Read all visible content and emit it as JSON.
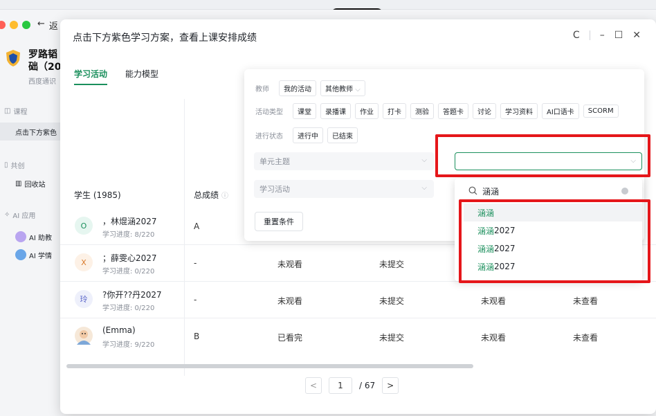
{
  "modal": {
    "title": "点击下方紫色学习方案，查看上课安排成绩",
    "ctrl_refresh": "C",
    "ctrl_min": "–",
    "ctrl_max": "☐",
    "ctrl_close": "✕"
  },
  "background": {
    "back_label": "返",
    "course_title": "罗路韬\n础（20",
    "course_sub": "西度通识",
    "nav_course_section": "课程",
    "nav_active_item": "点击下方紫色",
    "nav_shared_section": "共创",
    "nav_recycle": "回收站",
    "nav_ai_section": "AI 应用",
    "nav_ai_assistant": "AI 助教",
    "nav_ai_learning": "AI 学情"
  },
  "tabs": [
    {
      "label": "学习活动",
      "active": true
    },
    {
      "label": "能力模型",
      "active": false
    }
  ],
  "table": {
    "header_student": "学生 (1985)",
    "header_total": "总成绩",
    "rows": [
      {
        "avatar": "O",
        "avatar_color": "#e6f6f0",
        "avatar_text_color": "#1a8f5c",
        "name": "，林焜涵2027",
        "progress": "学习进度:  8/220",
        "total": "A",
        "c3": "",
        "c4": "",
        "c5": "",
        "c6": ""
      },
      {
        "avatar": "X",
        "avatar_color": "#fdf1e6",
        "avatar_text_color": "#d97a2b",
        "name": "；薛雯心2027",
        "progress": "学习进度:  0/220",
        "total": "-",
        "c3": "未观看",
        "c4": "未提交",
        "c5": "",
        "c6": ""
      },
      {
        "avatar": "玲",
        "avatar_color": "#eef0fb",
        "avatar_text_color": "#5b66c9",
        "name": "?你开??丹2027",
        "progress": "学习进度:  0/220",
        "total": "-",
        "c3": "未观看",
        "c4": "未提交",
        "c5": "未观看",
        "c6": "未查看"
      },
      {
        "avatar": "",
        "avatar_color": "#f6e8d8",
        "avatar_text_color": "#333",
        "name": "(Emma)",
        "progress": "学习进度:  9/220",
        "total": "B",
        "c3": "已看完",
        "c4": "未提交",
        "c5": "未观看",
        "c6": "未查看"
      }
    ]
  },
  "pager": {
    "prev": "<",
    "current": "1",
    "total": "/ 67",
    "next": ">"
  },
  "filter": {
    "teacher_label": "教师",
    "teacher_chips": [
      "我的活动",
      "其他教师"
    ],
    "type_label": "活动类型",
    "type_chips": [
      "课堂",
      "录播课",
      "作业",
      "打卡",
      "测验",
      "答题卡",
      "讨论",
      "学习资料",
      "AI口语卡",
      "SCORM"
    ],
    "status_label": "进行状态",
    "status_chips": [
      "进行中",
      "已结束"
    ],
    "unit_placeholder": "单元主题",
    "activity_placeholder": "学习活动",
    "reset_label": "重置条件"
  },
  "combo": {
    "search_text": "涵涵",
    "options": [
      {
        "hl": "涵涵",
        "rest": ""
      },
      {
        "hl": "涵涵",
        "rest": "2027"
      },
      {
        "hl": "涵涵",
        "rest": "2027"
      },
      {
        "hl": "涵涵",
        "rest": "2027"
      }
    ]
  },
  "colors": {
    "accent": "#1a8f5c",
    "highlight_box": "#e5161a"
  }
}
